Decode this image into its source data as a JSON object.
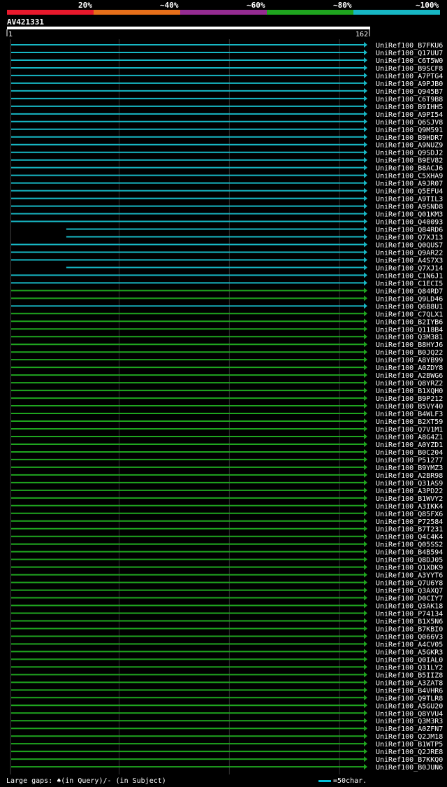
{
  "header": {
    "identity_labels": [
      "20%",
      "~40%",
      "~60%",
      "~80%",
      "~100%"
    ],
    "identity_colors": [
      "#e8192c",
      "#e66f1a",
      "#952c92",
      "#1fa51f",
      "#17b7c4"
    ],
    "query_id": "AV421331"
  },
  "chart_data": {
    "type": "alignment-overview",
    "query_length": 162,
    "axis": {
      "start_label": "1",
      "end_label": "162",
      "min": 1,
      "max": 162,
      "gridlines": [
        50,
        100,
        150
      ]
    },
    "status_colors": {
      "cyan": "#17b7c4",
      "green": "#1fa51f"
    },
    "rows": [
      {
        "name": "UniRef100_B7FKU6",
        "color": "cyan",
        "start": 1,
        "end": 162
      },
      {
        "name": "UniRef100_Q17UU7",
        "color": "cyan",
        "start": 1,
        "end": 162
      },
      {
        "name": "UniRef100_C6T5W0",
        "color": "cyan",
        "start": 1,
        "end": 162
      },
      {
        "name": "UniRef100_B9SCF8",
        "color": "cyan",
        "start": 1,
        "end": 162
      },
      {
        "name": "UniRef100_A7PTG4",
        "color": "cyan",
        "start": 1,
        "end": 162
      },
      {
        "name": "UniRef100_A9PJB0",
        "color": "cyan",
        "start": 1,
        "end": 162
      },
      {
        "name": "UniRef100_Q945B7",
        "color": "cyan",
        "start": 1,
        "end": 162
      },
      {
        "name": "UniRef100_C6T9B8",
        "color": "cyan",
        "start": 1,
        "end": 162
      },
      {
        "name": "UniRef100_B9IHH5",
        "color": "cyan",
        "start": 1,
        "end": 162
      },
      {
        "name": "UniRef100_A9PI54",
        "color": "cyan",
        "start": 1,
        "end": 162
      },
      {
        "name": "UniRef100_Q6SJV8",
        "color": "cyan",
        "start": 1,
        "end": 162
      },
      {
        "name": "UniRef100_Q9M591",
        "color": "cyan",
        "start": 1,
        "end": 162
      },
      {
        "name": "UniRef100_B9HDR7",
        "color": "cyan",
        "start": 1,
        "end": 162
      },
      {
        "name": "UniRef100_A9NUZ9",
        "color": "cyan",
        "start": 1,
        "end": 162
      },
      {
        "name": "UniRef100_Q9SDJ2",
        "color": "cyan",
        "start": 1,
        "end": 162
      },
      {
        "name": "UniRef100_B9EV82",
        "color": "cyan",
        "start": 1,
        "end": 162
      },
      {
        "name": "UniRef100_B8ACJ6",
        "color": "cyan",
        "start": 1,
        "end": 162
      },
      {
        "name": "UniRef100_C5XHA9",
        "color": "cyan",
        "start": 1,
        "end": 162
      },
      {
        "name": "UniRef100_A9JR07",
        "color": "cyan",
        "start": 1,
        "end": 162
      },
      {
        "name": "UniRef100_Q5EFU4",
        "color": "cyan",
        "start": 1,
        "end": 162
      },
      {
        "name": "UniRef100_A9TIL3",
        "color": "cyan",
        "start": 1,
        "end": 162
      },
      {
        "name": "UniRef100_A9SND8",
        "color": "cyan",
        "start": 1,
        "end": 162
      },
      {
        "name": "UniRef100_Q01KM3",
        "color": "cyan",
        "start": 1,
        "end": 162
      },
      {
        "name": "UniRef100_Q40093",
        "color": "cyan",
        "start": 1,
        "end": 162
      },
      {
        "name": "UniRef100_Q84RD6",
        "color": "cyan",
        "start": 26,
        "end": 162
      },
      {
        "name": "UniRef100_Q7XJ13",
        "color": "cyan",
        "start": 26,
        "end": 162
      },
      {
        "name": "UniRef100_Q0QUS7",
        "color": "cyan",
        "start": 1,
        "end": 162
      },
      {
        "name": "UniRef100_Q9AR22",
        "color": "cyan",
        "start": 1,
        "end": 162
      },
      {
        "name": "UniRef100_A4S7X3",
        "color": "cyan",
        "start": 1,
        "end": 162
      },
      {
        "name": "UniRef100_Q7XJ14",
        "color": "cyan",
        "start": 26,
        "end": 162
      },
      {
        "name": "UniRef100_C1N6J1",
        "color": "cyan",
        "start": 1,
        "end": 162
      },
      {
        "name": "UniRef100_C1ECI5",
        "color": "cyan",
        "start": 1,
        "end": 162
      },
      {
        "name": "UniRef100_Q84RD7",
        "color": "green",
        "start": 1,
        "end": 162
      },
      {
        "name": "UniRef100_Q9LD46",
        "color": "green",
        "start": 1,
        "end": 162
      },
      {
        "name": "UniRef100_Q6B8U1",
        "color": "cyan",
        "start": 1,
        "end": 162
      },
      {
        "name": "UniRef100_C7QLX1",
        "color": "green",
        "start": 1,
        "end": 162
      },
      {
        "name": "UniRef100_B2IYB6",
        "color": "green",
        "start": 1,
        "end": 162
      },
      {
        "name": "UniRef100_Q118B4",
        "color": "green",
        "start": 1,
        "end": 162
      },
      {
        "name": "UniRef100_Q3M381",
        "color": "green",
        "start": 1,
        "end": 162
      },
      {
        "name": "UniRef100_B8HYJ6",
        "color": "green",
        "start": 1,
        "end": 162
      },
      {
        "name": "UniRef100_B0JQ22",
        "color": "green",
        "start": 1,
        "end": 162
      },
      {
        "name": "UniRef100_A8YB99",
        "color": "green",
        "start": 1,
        "end": 162
      },
      {
        "name": "UniRef100_A0ZDY8",
        "color": "green",
        "start": 1,
        "end": 162
      },
      {
        "name": "UniRef100_A2BWG6",
        "color": "green",
        "start": 1,
        "end": 162
      },
      {
        "name": "UniRef100_Q8YRZ2",
        "color": "green",
        "start": 1,
        "end": 162
      },
      {
        "name": "UniRef100_B1XQH0",
        "color": "green",
        "start": 1,
        "end": 162
      },
      {
        "name": "UniRef100_B9P212",
        "color": "green",
        "start": 1,
        "end": 162
      },
      {
        "name": "UniRef100_B5VY40",
        "color": "green",
        "start": 1,
        "end": 162
      },
      {
        "name": "UniRef100_B4WLF3",
        "color": "green",
        "start": 1,
        "end": 162
      },
      {
        "name": "UniRef100_B2XT59",
        "color": "green",
        "start": 1,
        "end": 162
      },
      {
        "name": "UniRef100_Q7V1M1",
        "color": "green",
        "start": 1,
        "end": 162
      },
      {
        "name": "UniRef100_A8G4Z1",
        "color": "green",
        "start": 1,
        "end": 162
      },
      {
        "name": "UniRef100_A0YZD1",
        "color": "green",
        "start": 1,
        "end": 162
      },
      {
        "name": "UniRef100_B0C204",
        "color": "green",
        "start": 1,
        "end": 162
      },
      {
        "name": "UniRef100_P51277",
        "color": "green",
        "start": 1,
        "end": 162
      },
      {
        "name": "UniRef100_B9YMZ3",
        "color": "green",
        "start": 1,
        "end": 162
      },
      {
        "name": "UniRef100_A2BR98",
        "color": "green",
        "start": 1,
        "end": 162
      },
      {
        "name": "UniRef100_Q31AS9",
        "color": "green",
        "start": 1,
        "end": 162
      },
      {
        "name": "UniRef100_A3PD22",
        "color": "green",
        "start": 1,
        "end": 162
      },
      {
        "name": "UniRef100_B1WVY2",
        "color": "green",
        "start": 1,
        "end": 162
      },
      {
        "name": "UniRef100_A3IKK4",
        "color": "green",
        "start": 1,
        "end": 162
      },
      {
        "name": "UniRef100_Q85FX6",
        "color": "green",
        "start": 1,
        "end": 162
      },
      {
        "name": "UniRef100_P72584",
        "color": "green",
        "start": 1,
        "end": 162
      },
      {
        "name": "UniRef100_B7T231",
        "color": "green",
        "start": 1,
        "end": 162
      },
      {
        "name": "UniRef100_Q4C4K4",
        "color": "green",
        "start": 1,
        "end": 162
      },
      {
        "name": "UniRef100_Q05SS2",
        "color": "green",
        "start": 1,
        "end": 162
      },
      {
        "name": "UniRef100_B4B594",
        "color": "green",
        "start": 1,
        "end": 162
      },
      {
        "name": "UniRef100_Q8DJ05",
        "color": "green",
        "start": 1,
        "end": 162
      },
      {
        "name": "UniRef100_Q1XDK9",
        "color": "green",
        "start": 1,
        "end": 162
      },
      {
        "name": "UniRef100_A3YYT6",
        "color": "green",
        "start": 1,
        "end": 162
      },
      {
        "name": "UniRef100_Q7U6Y8",
        "color": "green",
        "start": 1,
        "end": 162
      },
      {
        "name": "UniRef100_Q3AXQ7",
        "color": "green",
        "start": 1,
        "end": 162
      },
      {
        "name": "UniRef100_D0CIY7",
        "color": "green",
        "start": 1,
        "end": 162
      },
      {
        "name": "UniRef100_Q3AK18",
        "color": "green",
        "start": 1,
        "end": 162
      },
      {
        "name": "UniRef100_P74134",
        "color": "green",
        "start": 1,
        "end": 162
      },
      {
        "name": "UniRef100_B1X5N6",
        "color": "green",
        "start": 1,
        "end": 162
      },
      {
        "name": "UniRef100_B7KBI0",
        "color": "green",
        "start": 1,
        "end": 162
      },
      {
        "name": "UniRef100_Q066V3",
        "color": "green",
        "start": 1,
        "end": 162
      },
      {
        "name": "UniRef100_A4CV05",
        "color": "green",
        "start": 1,
        "end": 162
      },
      {
        "name": "UniRef100_A5GKR3",
        "color": "green",
        "start": 1,
        "end": 162
      },
      {
        "name": "UniRef100_Q0IAL0",
        "color": "green",
        "start": 1,
        "end": 162
      },
      {
        "name": "UniRef100_Q31LY2",
        "color": "green",
        "start": 1,
        "end": 162
      },
      {
        "name": "UniRef100_B5IIZ8",
        "color": "green",
        "start": 1,
        "end": 162
      },
      {
        "name": "UniRef100_A3ZAT8",
        "color": "green",
        "start": 1,
        "end": 162
      },
      {
        "name": "UniRef100_B4VHR6",
        "color": "green",
        "start": 1,
        "end": 162
      },
      {
        "name": "UniRef100_Q9TLR8",
        "color": "green",
        "start": 1,
        "end": 162
      },
      {
        "name": "UniRef100_A5GU20",
        "color": "green",
        "start": 1,
        "end": 162
      },
      {
        "name": "UniRef100_Q8YVU4",
        "color": "green",
        "start": 1,
        "end": 162
      },
      {
        "name": "UniRef100_Q3M3R3",
        "color": "green",
        "start": 1,
        "end": 162
      },
      {
        "name": "UniRef100_A0ZFN7",
        "color": "green",
        "start": 1,
        "end": 162
      },
      {
        "name": "UniRef100_Q2JM18",
        "color": "green",
        "start": 1,
        "end": 162
      },
      {
        "name": "UniRef100_B1WTP5",
        "color": "green",
        "start": 1,
        "end": 162
      },
      {
        "name": "UniRef100_Q2JRE8",
        "color": "green",
        "start": 1,
        "end": 162
      },
      {
        "name": "UniRef100_B7KKQ0",
        "color": "green",
        "start": 1,
        "end": 162
      },
      {
        "name": "UniRef100_B0JUN6",
        "color": "green",
        "start": 1,
        "end": 162
      }
    ]
  },
  "footer": {
    "legend_text": "Large gaps: ♠(in Query)/- (in Subject)",
    "scale_text": "=50char."
  }
}
